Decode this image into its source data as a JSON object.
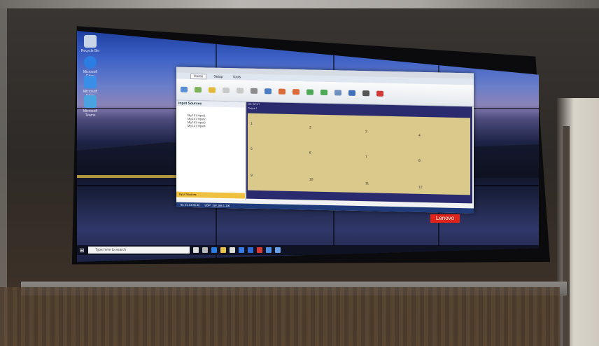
{
  "desktop_icons": [
    {
      "label": "Recycle Bin",
      "icon": "recycle-bin-icon",
      "color": "#c8d4e8"
    },
    {
      "label": "Microsoft Edge",
      "icon": "edge-icon",
      "color": "#2b7de1"
    },
    {
      "label": "Microsoft Edge",
      "icon": "edge-icon",
      "color": "#3a8ee8"
    },
    {
      "label": "Microsoft Teams",
      "icon": "app-icon",
      "color": "#4aa3e0"
    }
  ],
  "app": {
    "tabs": [
      "Home",
      "Setup",
      "Tools"
    ],
    "side_head": "Input Sources",
    "side_items": [
      "Mg 101 Input1",
      "Mg 101 Input2",
      "Mg 101 Input3",
      "Mg 101 Input4"
    ],
    "side_footer": "Input Sources",
    "canvas_info": [
      "101 INPUT",
      "Output 1"
    ],
    "tile_numbers": [
      "1",
      "2",
      "3",
      "4",
      "5",
      "6",
      "7",
      "8",
      "9",
      "10",
      "11",
      "12"
    ],
    "status": [
      "ID: 21.14.66.40",
      "UDP: 192.168.1.100"
    ]
  },
  "brand": "Lenovo",
  "taskbar": {
    "search_placeholder": "Type here to search",
    "time": "",
    "icons": [
      "task-view-icon",
      "explorer-icon",
      "edge-icon",
      "folder-icon",
      "store-icon",
      "mail-icon",
      "app-icon",
      "app-icon",
      "app-icon",
      "app-icon"
    ]
  },
  "colors": {
    "brand_red": "#e2231a",
    "tile_fill": "#d9c98a",
    "canvas_bg": "#2a2a6e",
    "taskbar": "#0f1222"
  }
}
